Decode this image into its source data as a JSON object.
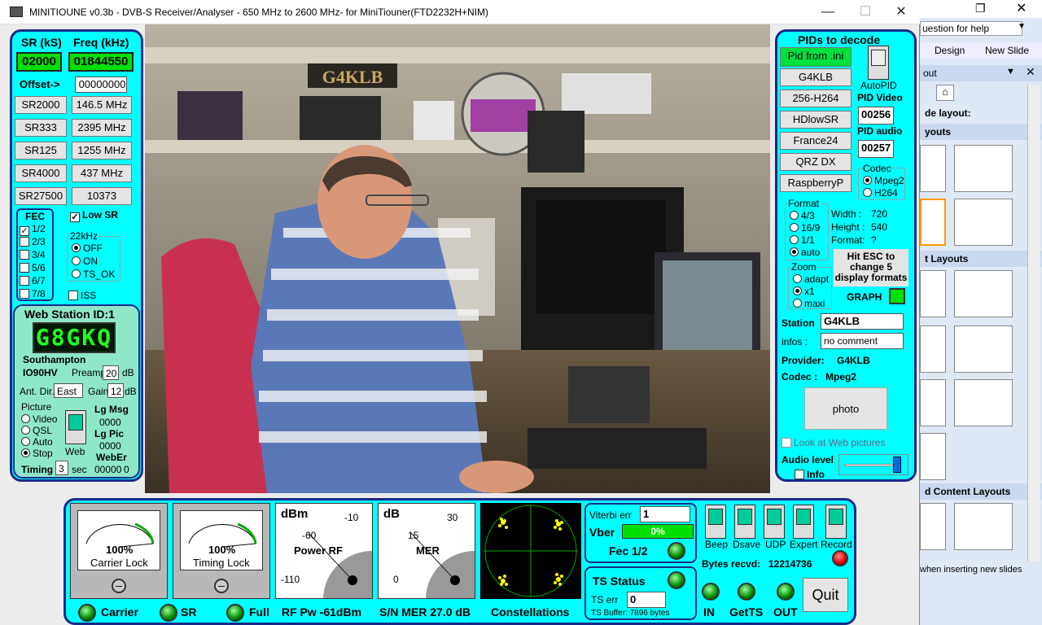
{
  "window": {
    "title": "MINITIOUNE v0.3b - DVB-S Receiver/Analyser - 650 MHz to 2600 MHz- for MiniTiouner(FTD2232H+NIM)"
  },
  "left": {
    "sr_label": "SR (kS)",
    "freq_label": "Freq (kHz)",
    "sr_value": "02000",
    "freq_value": "01844550",
    "offset_label": "Offset->",
    "offset_value": "00000000",
    "sr_buttons": [
      "SR2000",
      "SR333",
      "SR125",
      "SR4000",
      "SR27500"
    ],
    "freq_buttons": [
      "146.5 MHz",
      "2395 MHz",
      "1255 MHz",
      "437 MHz",
      "10373"
    ],
    "fec_label": "FEC",
    "fec_options": [
      "1/2",
      "2/3",
      "3/4",
      "5/6",
      "6/7",
      "7/8"
    ],
    "fec_checked": "1/2",
    "low_sr": "Low SR",
    "k22_label": "22kHz",
    "k22_options": [
      "OFF",
      "ON",
      "TS_OK"
    ],
    "iss": "ISS"
  },
  "station": {
    "title": "Web Station ID:1",
    "callsign": "G8GKQ",
    "city": "Southampton",
    "locator": "IO90HV",
    "preamp_label": "Preamp",
    "preamp_value": "20",
    "db1": "dB",
    "antdir_label": "Ant. Dir.",
    "antdir_value": "East",
    "gain_label": "Gain",
    "gain_value": "12",
    "db2": "dB",
    "picture_label": "Picture",
    "picture_options": [
      "Video",
      "QSL",
      "Auto",
      "Stop"
    ],
    "web_label": "Web",
    "lgmsg_label": "Lg Msg",
    "lgmsg_value": "0000",
    "lgpic_label": "Lg Pic",
    "lgpic_value": "0000",
    "weber_label": "WebEr",
    "weber_value": "00000",
    "weber_value2": "0",
    "timing_label": "Timing",
    "timing_value": "3",
    "sec": "sec"
  },
  "video": {
    "sign_text": "G4KLB"
  },
  "right": {
    "title": "PIDs to decode",
    "pid_ini": "Pid from .ini",
    "presets": [
      "G4KLB",
      "256-H264",
      "HDlowSR",
      "France24",
      "QRZ DX",
      "RaspberryP"
    ],
    "autopid": "AutoPID",
    "pid_video_label": "PID Video",
    "pid_video": "00256",
    "pid_audio_label": "PID audio",
    "pid_audio": "00257",
    "codec_label": "Codec",
    "codec_options": [
      "Mpeg2",
      "H264"
    ],
    "format_label": "Format",
    "format_options": [
      "4/3",
      "16/9",
      "1/1",
      "auto"
    ],
    "width_label": "Width :",
    "width_value": "720",
    "height_label": "Height :",
    "height_value": "540",
    "format_info_label": "Format:",
    "format_info_value": "?",
    "zoom_label": "Zoom",
    "zoom_options": [
      "adapt",
      "x1",
      "maxi"
    ],
    "esc_text": "Hit ESC to change 5 display formats",
    "graph_label": "GRAPH",
    "station_label": "Station",
    "station_value": "G4KLB",
    "infos_label": "infos :",
    "infos_value": "no comment",
    "provider_label": "Provider:",
    "provider_value": "G4KLB",
    "codec2_label": "Codec :",
    "codec2_value": "Mpeg2",
    "photo": "photo",
    "look_web": "Look at Web pictures",
    "audio_label": "Audio level",
    "info_label": "Info"
  },
  "bottom": {
    "g1_pct": "100%",
    "g1_label": "Carrier Lock",
    "g2_pct": "100%",
    "g2_label": "Timing Lock",
    "rf_unit": "dBm",
    "rf_t1": "-10",
    "rf_t2": "-60",
    "rf_name": "Power RF",
    "rf_t3": "-110",
    "mer_unit": "dB",
    "mer_t1": "30",
    "mer_t2": "15",
    "mer_name": "MER",
    "mer_t3": "0",
    "carrier": "Carrier",
    "sr": "SR",
    "full": "Full",
    "rf_pw": "RF Pw -61dBm",
    "sn_mer": "S/N MER  27.0 dB",
    "constellations": "Constellations",
    "viterbi_label": "Viterbi err",
    "viterbi_value": "1",
    "vber_label": "Vber",
    "vber_value": "0%",
    "fec": "Fec 1/2",
    "ts_status": "TS Status",
    "ts_err_label": "TS err",
    "ts_err_value": "0",
    "ts_buffer": "TS Buffer: 7896 bytes",
    "switches": [
      "Beep",
      "Dsave",
      "UDP",
      "Expert",
      "Record"
    ],
    "bytes_label": "Bytes recvd:",
    "bytes_value": "12214736",
    "leds": [
      "IN",
      "GetTS",
      "OUT"
    ],
    "quit": "Quit"
  },
  "ppt": {
    "help": "uestion for help",
    "design": "Design",
    "new_slide": "New Slide",
    "pane_title": "out",
    "slide_layout": "de layout:",
    "h1": "youts",
    "h2": "t Layouts",
    "h3": "d Content Layouts",
    "footer": "when inserting new slides"
  }
}
